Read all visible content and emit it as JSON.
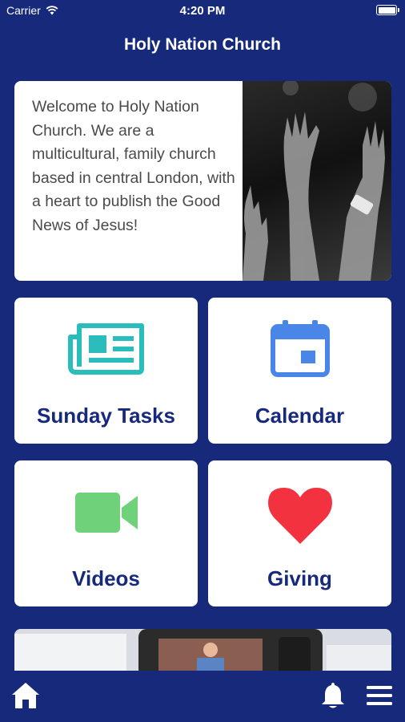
{
  "status_bar": {
    "carrier": "Carrier",
    "time": "4:20 PM"
  },
  "header": {
    "title": "Holy Nation Church"
  },
  "welcome": {
    "text": "Welcome to Holy Nation Church. We are a multicultural, family church based in central London, with a heart to publish the Good News of Jesus!"
  },
  "tiles": [
    {
      "label": "Sunday Tasks",
      "icon": "newspaper-icon",
      "icon_color": "#2bbcbc"
    },
    {
      "label": "Calendar",
      "icon": "calendar-icon",
      "icon_color": "#4a85e8"
    },
    {
      "label": "Videos",
      "icon": "video-camera-icon",
      "icon_color": "#6fd27a"
    },
    {
      "label": "Giving",
      "icon": "heart-icon",
      "icon_color": "#f2323f"
    }
  ],
  "colors": {
    "background": "#17297a",
    "tile_text": "#17297a"
  },
  "bottom_bar": {
    "icons": [
      "home-icon",
      "bell-icon",
      "menu-icon"
    ]
  }
}
